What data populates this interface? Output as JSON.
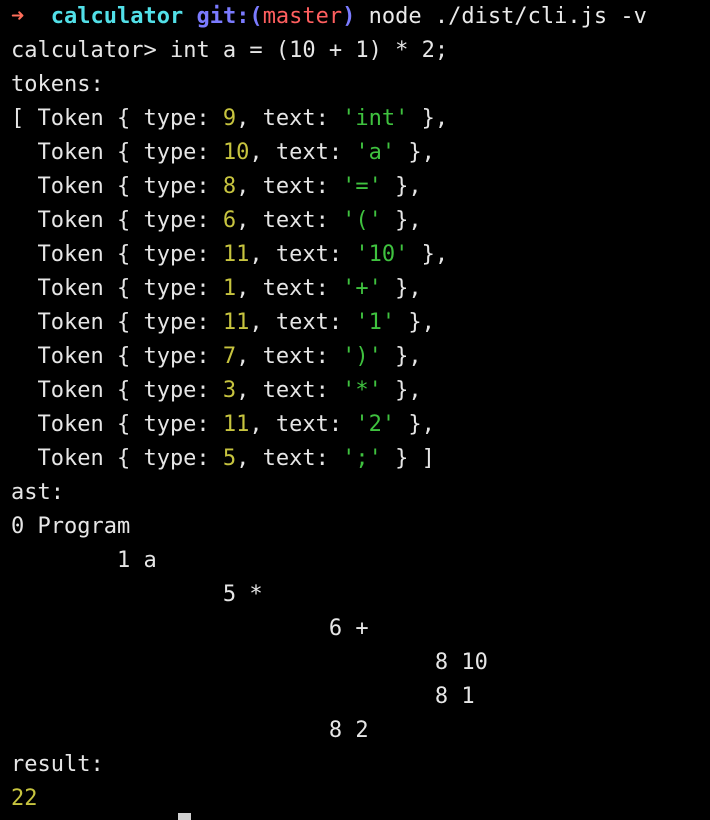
{
  "prompt": {
    "arrow": "➜",
    "directory": "calculator",
    "git_prefix": "git:(",
    "branch": "master",
    "git_suffix": ")",
    "command": "node ./dist/cli.js -v"
  },
  "repl": {
    "prompt": "calculator>",
    "input": "int a = (10 + 1) * 2;"
  },
  "tokens_label": "tokens:",
  "tokens": [
    {
      "type": "9",
      "text": "'int'"
    },
    {
      "type": "10",
      "text": "'a'"
    },
    {
      "type": "8",
      "text": "'='"
    },
    {
      "type": "6",
      "text": "'('"
    },
    {
      "type": "11",
      "text": "'10'"
    },
    {
      "type": "1",
      "text": "'+'"
    },
    {
      "type": "11",
      "text": "'1'"
    },
    {
      "type": "7",
      "text": "')'"
    },
    {
      "type": "3",
      "text": "'*'"
    },
    {
      "type": "11",
      "text": "'2'"
    },
    {
      "type": "5",
      "text": "';'"
    }
  ],
  "ast_label": "ast:",
  "ast": [
    {
      "depth": 0,
      "text": "0 Program"
    },
    {
      "depth": 1,
      "text": "1 a"
    },
    {
      "depth": 2,
      "text": "5 *"
    },
    {
      "depth": 3,
      "text": "6 +"
    },
    {
      "depth": 4,
      "text": "8 10"
    },
    {
      "depth": 4,
      "text": "8 1"
    },
    {
      "depth": 3,
      "text": "8 2"
    }
  ],
  "result_label": "result:",
  "result_value": "22",
  "colors": {
    "background": "#000000",
    "foreground": "#e6e6e6",
    "arrow": "#ff6e5a",
    "directory": "#52e0e8",
    "git": "#7b7bff",
    "branch": "#ff5f5f",
    "number": "#c7c43f",
    "string": "#3fc23f"
  }
}
